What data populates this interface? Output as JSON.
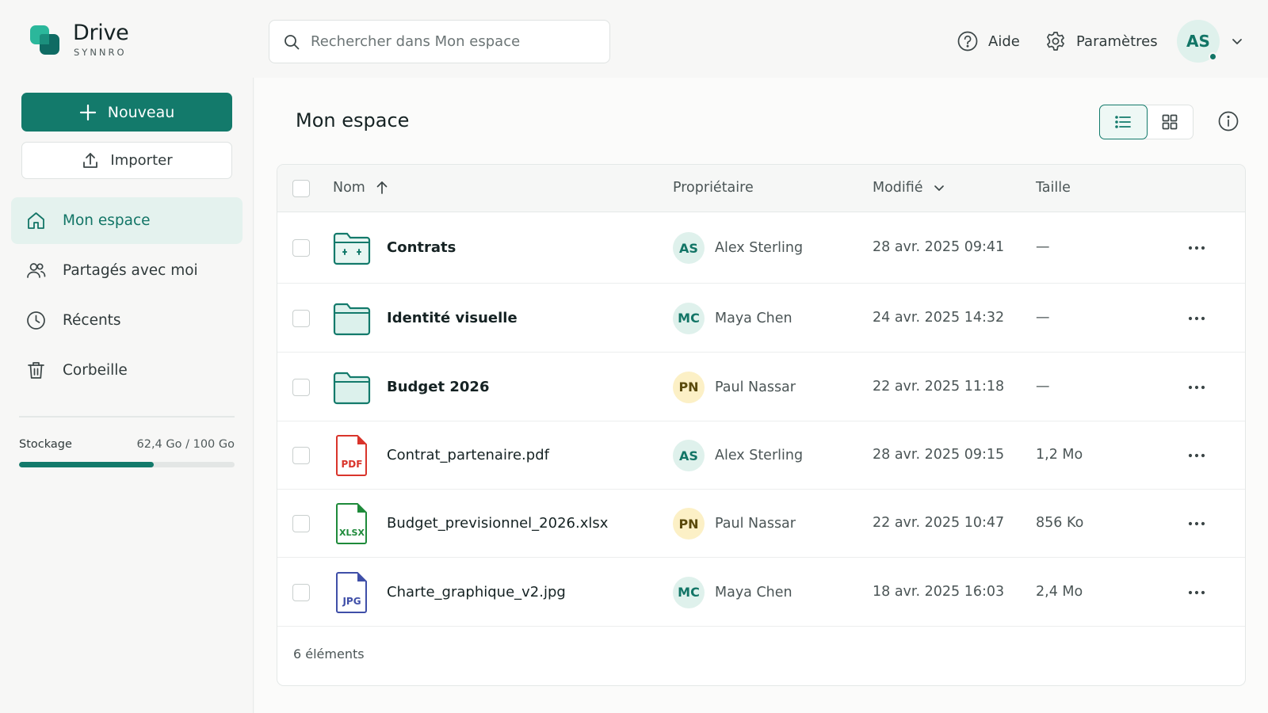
{
  "brand": {
    "name": "Drive",
    "sub": "SYNNRO",
    "colors": {
      "accent": "#137a6b",
      "accent_light": "#e4f2ee"
    }
  },
  "search": {
    "placeholder": "Rechercher dans Mon espace",
    "value": ""
  },
  "header": {
    "help_label": "Aide",
    "settings_label": "Paramètres",
    "user_initials": "AS"
  },
  "sidebar": {
    "new_label": "Nouveau",
    "import_label": "Importer",
    "items": [
      {
        "label": "Mon espace",
        "icon": "home-icon",
        "active": true
      },
      {
        "label": "Partagés avec moi",
        "icon": "users-icon",
        "active": false
      },
      {
        "label": "Récents",
        "icon": "clock-icon",
        "active": false
      },
      {
        "label": "Corbeille",
        "icon": "trash-icon",
        "active": false
      }
    ],
    "storage": {
      "label": "Stockage",
      "value_text": "62,4 Go / 100 Go",
      "used_fraction": 0.624
    }
  },
  "main": {
    "title": "Mon espace",
    "view_mode": "list",
    "columns": {
      "name": "Nom",
      "owner": "Propriétaire",
      "modified": "Modifié",
      "size": "Taille"
    },
    "files": [
      {
        "name": "Contrats",
        "type": "folder-contract",
        "owner": "Alex Sterling",
        "initials": "AS",
        "avatar_color": "teal",
        "modified": "28 avr. 2025 09:41",
        "size": "—"
      },
      {
        "name": "Identité visuelle",
        "type": "folder",
        "owner": "Maya Chen",
        "initials": "MC",
        "avatar_color": "teal",
        "modified": "24 avr. 2025 14:32",
        "size": "—"
      },
      {
        "name": "Budget 2026",
        "type": "folder",
        "owner": "Paul Nassar",
        "initials": "PN",
        "avatar_color": "yellow",
        "modified": "22 avr. 2025 11:18",
        "size": "—"
      },
      {
        "name": "Contrat_partenaire.pdf",
        "type": "pdf",
        "badge": "PDF",
        "owner": "Alex Sterling",
        "initials": "AS",
        "avatar_color": "teal",
        "modified": "28 avr. 2025 09:15",
        "size": "1,2 Mo"
      },
      {
        "name": "Budget_previsionnel_2026.xlsx",
        "type": "xlsx",
        "badge": "XLSX",
        "owner": "Paul Nassar",
        "initials": "PN",
        "avatar_color": "yellow",
        "modified": "22 avr. 2025 10:47",
        "size": "856 Ko"
      },
      {
        "name": "Charte_graphique_v2.jpg",
        "type": "jpg",
        "badge": "JPG",
        "owner": "Maya Chen",
        "initials": "MC",
        "avatar_color": "teal",
        "modified": "18 avr. 2025 16:03",
        "size": "2,4 Mo"
      }
    ],
    "item_count": "6 éléments"
  }
}
